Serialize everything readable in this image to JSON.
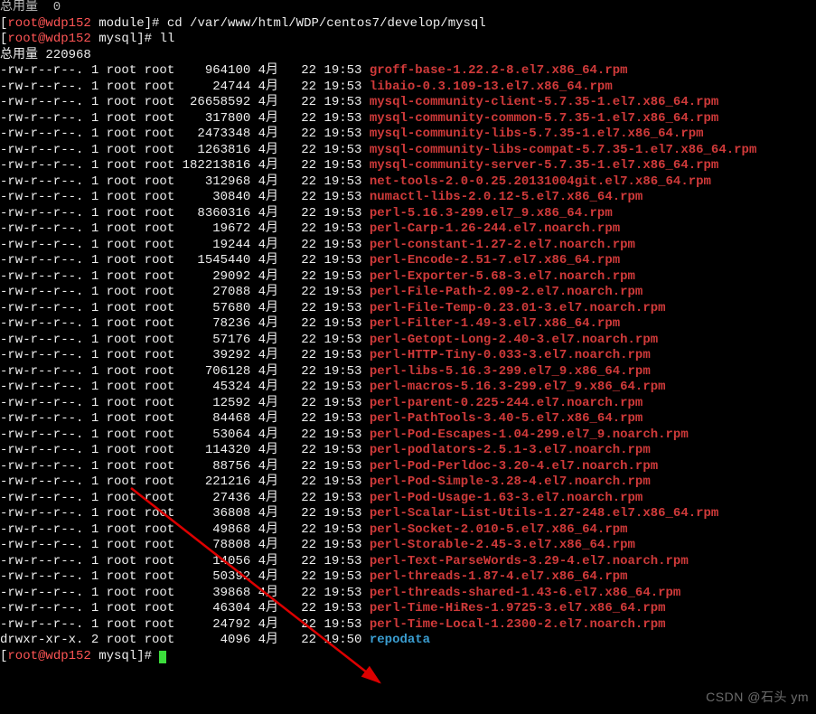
{
  "top_cutoff": "总用量  0",
  "prompt1": {
    "user": "root",
    "host": "wdp152",
    "dir": "module",
    "cmd": "cd /var/www/html/WDP/centos7/develop/mysql"
  },
  "prompt2": {
    "user": "root",
    "host": "wdp152",
    "dir": "mysql",
    "cmd": "ll"
  },
  "total_label": "总用量 220968",
  "month": "4月",
  "date_short": "22 19:53",
  "date_wide": "22 19:50",
  "files": [
    {
      "perm": "-rw-r--r--.",
      "links": "1",
      "owner": "root",
      "group": "root",
      "size": "964100",
      "name": "groff-base-1.22.2-8.el7.x86_64.rpm"
    },
    {
      "perm": "-rw-r--r--.",
      "links": "1",
      "owner": "root",
      "group": "root",
      "size": "24744",
      "name": "libaio-0.3.109-13.el7.x86_64.rpm"
    },
    {
      "perm": "-rw-r--r--.",
      "links": "1",
      "owner": "root",
      "group": "root",
      "size": "26658592",
      "name": "mysql-community-client-5.7.35-1.el7.x86_64.rpm"
    },
    {
      "perm": "-rw-r--r--.",
      "links": "1",
      "owner": "root",
      "group": "root",
      "size": "317800",
      "name": "mysql-community-common-5.7.35-1.el7.x86_64.rpm"
    },
    {
      "perm": "-rw-r--r--.",
      "links": "1",
      "owner": "root",
      "group": "root",
      "size": "2473348",
      "name": "mysql-community-libs-5.7.35-1.el7.x86_64.rpm"
    },
    {
      "perm": "-rw-r--r--.",
      "links": "1",
      "owner": "root",
      "group": "root",
      "size": "1263816",
      "name": "mysql-community-libs-compat-5.7.35-1.el7.x86_64.rpm"
    },
    {
      "perm": "-rw-r--r--.",
      "links": "1",
      "owner": "root",
      "group": "root",
      "size": "182213816",
      "name": "mysql-community-server-5.7.35-1.el7.x86_64.rpm"
    },
    {
      "perm": "-rw-r--r--.",
      "links": "1",
      "owner": "root",
      "group": "root",
      "size": "312968",
      "name": "net-tools-2.0-0.25.20131004git.el7.x86_64.rpm"
    },
    {
      "perm": "-rw-r--r--.",
      "links": "1",
      "owner": "root",
      "group": "root",
      "size": "30840",
      "name": "numactl-libs-2.0.12-5.el7.x86_64.rpm"
    },
    {
      "perm": "-rw-r--r--.",
      "links": "1",
      "owner": "root",
      "group": "root",
      "size": "8360316",
      "name": "perl-5.16.3-299.el7_9.x86_64.rpm"
    },
    {
      "perm": "-rw-r--r--.",
      "links": "1",
      "owner": "root",
      "group": "root",
      "size": "19672",
      "name": "perl-Carp-1.26-244.el7.noarch.rpm"
    },
    {
      "perm": "-rw-r--r--.",
      "links": "1",
      "owner": "root",
      "group": "root",
      "size": "19244",
      "name": "perl-constant-1.27-2.el7.noarch.rpm"
    },
    {
      "perm": "-rw-r--r--.",
      "links": "1",
      "owner": "root",
      "group": "root",
      "size": "1545440",
      "name": "perl-Encode-2.51-7.el7.x86_64.rpm"
    },
    {
      "perm": "-rw-r--r--.",
      "links": "1",
      "owner": "root",
      "group": "root",
      "size": "29092",
      "name": "perl-Exporter-5.68-3.el7.noarch.rpm"
    },
    {
      "perm": "-rw-r--r--.",
      "links": "1",
      "owner": "root",
      "group": "root",
      "size": "27088",
      "name": "perl-File-Path-2.09-2.el7.noarch.rpm"
    },
    {
      "perm": "-rw-r--r--.",
      "links": "1",
      "owner": "root",
      "group": "root",
      "size": "57680",
      "name": "perl-File-Temp-0.23.01-3.el7.noarch.rpm"
    },
    {
      "perm": "-rw-r--r--.",
      "links": "1",
      "owner": "root",
      "group": "root",
      "size": "78236",
      "name": "perl-Filter-1.49-3.el7.x86_64.rpm"
    },
    {
      "perm": "-rw-r--r--.",
      "links": "1",
      "owner": "root",
      "group": "root",
      "size": "57176",
      "name": "perl-Getopt-Long-2.40-3.el7.noarch.rpm"
    },
    {
      "perm": "-rw-r--r--.",
      "links": "1",
      "owner": "root",
      "group": "root",
      "size": "39292",
      "name": "perl-HTTP-Tiny-0.033-3.el7.noarch.rpm"
    },
    {
      "perm": "-rw-r--r--.",
      "links": "1",
      "owner": "root",
      "group": "root",
      "size": "706128",
      "name": "perl-libs-5.16.3-299.el7_9.x86_64.rpm"
    },
    {
      "perm": "-rw-r--r--.",
      "links": "1",
      "owner": "root",
      "group": "root",
      "size": "45324",
      "name": "perl-macros-5.16.3-299.el7_9.x86_64.rpm"
    },
    {
      "perm": "-rw-r--r--.",
      "links": "1",
      "owner": "root",
      "group": "root",
      "size": "12592",
      "name": "perl-parent-0.225-244.el7.noarch.rpm"
    },
    {
      "perm": "-rw-r--r--.",
      "links": "1",
      "owner": "root",
      "group": "root",
      "size": "84468",
      "name": "perl-PathTools-3.40-5.el7.x86_64.rpm"
    },
    {
      "perm": "-rw-r--r--.",
      "links": "1",
      "owner": "root",
      "group": "root",
      "size": "53064",
      "name": "perl-Pod-Escapes-1.04-299.el7_9.noarch.rpm"
    },
    {
      "perm": "-rw-r--r--.",
      "links": "1",
      "owner": "root",
      "group": "root",
      "size": "114320",
      "name": "perl-podlators-2.5.1-3.el7.noarch.rpm"
    },
    {
      "perm": "-rw-r--r--.",
      "links": "1",
      "owner": "root",
      "group": "root",
      "size": "88756",
      "name": "perl-Pod-Perldoc-3.20-4.el7.noarch.rpm"
    },
    {
      "perm": "-rw-r--r--.",
      "links": "1",
      "owner": "root",
      "group": "root",
      "size": "221216",
      "name": "perl-Pod-Simple-3.28-4.el7.noarch.rpm"
    },
    {
      "perm": "-rw-r--r--.",
      "links": "1",
      "owner": "root",
      "group": "root",
      "size": "27436",
      "name": "perl-Pod-Usage-1.63-3.el7.noarch.rpm"
    },
    {
      "perm": "-rw-r--r--.",
      "links": "1",
      "owner": "root",
      "group": "root",
      "size": "36808",
      "name": "perl-Scalar-List-Utils-1.27-248.el7.x86_64.rpm"
    },
    {
      "perm": "-rw-r--r--.",
      "links": "1",
      "owner": "root",
      "group": "root",
      "size": "49868",
      "name": "perl-Socket-2.010-5.el7.x86_64.rpm"
    },
    {
      "perm": "-rw-r--r--.",
      "links": "1",
      "owner": "root",
      "group": "root",
      "size": "78808",
      "name": "perl-Storable-2.45-3.el7.x86_64.rpm"
    },
    {
      "perm": "-rw-r--r--.",
      "links": "1",
      "owner": "root",
      "group": "root",
      "size": "14056",
      "name": "perl-Text-ParseWords-3.29-4.el7.noarch.rpm"
    },
    {
      "perm": "-rw-r--r--.",
      "links": "1",
      "owner": "root",
      "group": "root",
      "size": "50392",
      "name": "perl-threads-1.87-4.el7.x86_64.rpm"
    },
    {
      "perm": "-rw-r--r--.",
      "links": "1",
      "owner": "root",
      "group": "root",
      "size": "39868",
      "name": "perl-threads-shared-1.43-6.el7.x86_64.rpm"
    },
    {
      "perm": "-rw-r--r--.",
      "links": "1",
      "owner": "root",
      "group": "root",
      "size": "46304",
      "name": "perl-Time-HiRes-1.9725-3.el7.x86_64.rpm"
    },
    {
      "perm": "-rw-r--r--.",
      "links": "1",
      "owner": "root",
      "group": "root",
      "size": "24792",
      "name": "perl-Time-Local-1.2300-2.el7.noarch.rpm"
    },
    {
      "perm": "drwxr-xr-x.",
      "links": "2",
      "owner": "root",
      "group": "root",
      "size": "4096",
      "name": "repodata",
      "is_dir": true,
      "wide": true
    }
  ],
  "prompt3": {
    "user": "root",
    "host": "wdp152",
    "dir": "mysql"
  },
  "watermark": "CSDN @石头 ym"
}
